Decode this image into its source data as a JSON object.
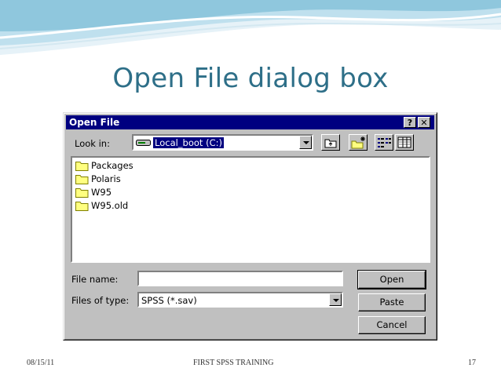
{
  "slide": {
    "title": "Open File dialog box",
    "footer_date": "08/15/11",
    "footer_center": "FIRST SPSS TRAINING",
    "page_number": "17"
  },
  "dialog": {
    "title": "Open File",
    "help_button": "?",
    "close_button": "✕",
    "look_in_label": "Look in:",
    "look_in_value": "Local_boot (C:)",
    "files": [
      {
        "name": "Packages"
      },
      {
        "name": "Polaris"
      },
      {
        "name": "W95"
      },
      {
        "name": "W95.old"
      }
    ],
    "file_name_label": "File name:",
    "file_name_value": "",
    "files_of_type_label": "Files of type:",
    "files_of_type_value": "SPSS (*.sav)",
    "open_button": "Open",
    "paste_button": "Paste",
    "cancel_button": "Cancel",
    "icons": [
      "drive-icon",
      "up-folder-icon",
      "new-folder-icon",
      "list-view-icon",
      "details-view-icon",
      "folder-icon"
    ]
  },
  "colors": {
    "title_color": "#2e6f88",
    "titlebar": "#000080",
    "dialog_face": "#c0c0c0"
  }
}
